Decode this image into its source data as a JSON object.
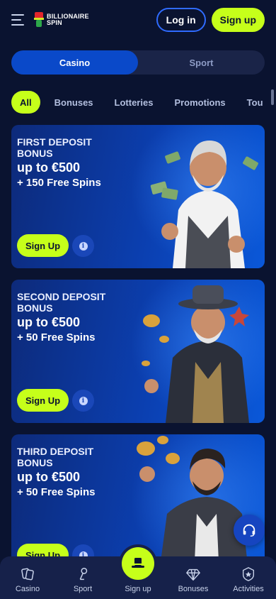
{
  "header": {
    "logo_line1": "BILLIONAIRE",
    "logo_line2": "SPIN",
    "login_label": "Log in",
    "signup_label": "Sign up"
  },
  "toggle": {
    "options": [
      "Casino",
      "Sport"
    ],
    "active": "Casino"
  },
  "filters": {
    "items": [
      "All",
      "Bonuses",
      "Lotteries",
      "Promotions",
      "Tou"
    ],
    "active": "All"
  },
  "cards": [
    {
      "title_line1": "FIRST DEPOSIT",
      "title_line2": "BONUS",
      "amount": "up to €500",
      "spins": "+ 150 Free Spins",
      "button_label": "Sign Up",
      "info_icon": "info-icon"
    },
    {
      "title_line1": "SECOND DEPOSIT",
      "title_line2": "BONUS",
      "amount": "up to €500",
      "spins": "+ 50 Free Spins",
      "button_label": "Sign Up",
      "info_icon": "info-icon"
    },
    {
      "title_line1": "THIRD DEPOSIT",
      "title_line2": "BONUS",
      "amount": "up to €500",
      "spins": "+ 50 Free Spins",
      "button_label": "Sign Up",
      "info_icon": "info-icon"
    }
  ],
  "bottom_nav": {
    "items": [
      {
        "label": "Casino",
        "icon": "cards-icon"
      },
      {
        "label": "Sport",
        "icon": "sport-icon"
      },
      {
        "label": "Sign up",
        "icon": "top-hat-icon"
      },
      {
        "label": "Bonuses",
        "icon": "diamond-icon"
      },
      {
        "label": "Activities",
        "icon": "badge-icon"
      }
    ]
  },
  "colors": {
    "background": "#0a1330",
    "accent": "#c6ff1a",
    "primary_blue": "#0a49c9"
  }
}
